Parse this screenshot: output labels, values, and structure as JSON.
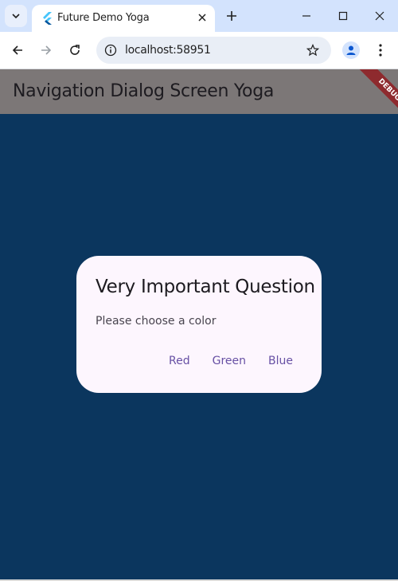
{
  "browser": {
    "tab_title": "Future Demo Yoga",
    "url": "localhost:58951"
  },
  "app": {
    "appbar_title": "Navigation Dialog Screen Yoga",
    "debug_label": "DEBUG",
    "background_color": "#0b365e",
    "appbar_color": "#7c7777"
  },
  "dialog": {
    "title": "Very Important Question",
    "content": "Please choose a color",
    "actions": {
      "red": "Red",
      "green": "Green",
      "blue": "Blue"
    },
    "accent_color": "#6750a4"
  }
}
